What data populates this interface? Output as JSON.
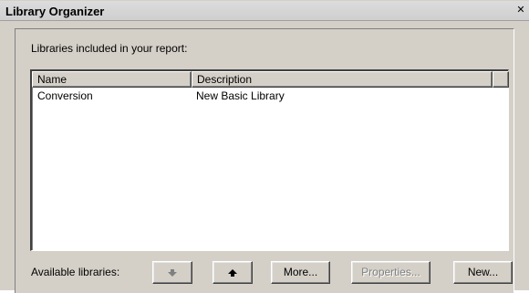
{
  "window": {
    "title": "Library Organizer",
    "close_glyph": "✕"
  },
  "included": {
    "label": "Libraries included in your report:",
    "columns": [
      "Name",
      "Description",
      ""
    ],
    "rows": [
      {
        "name": "Conversion",
        "description": "New Basic Library"
      }
    ]
  },
  "available": {
    "label": "Available libraries:"
  },
  "buttons": {
    "move_down_icon": "arrow-down-icon",
    "move_up_icon": "arrow-up-icon",
    "more": "More...",
    "properties": "Properties...",
    "new": "New..."
  },
  "colors": {
    "face": "#d4d0c8",
    "disabled_text": "#808080"
  }
}
